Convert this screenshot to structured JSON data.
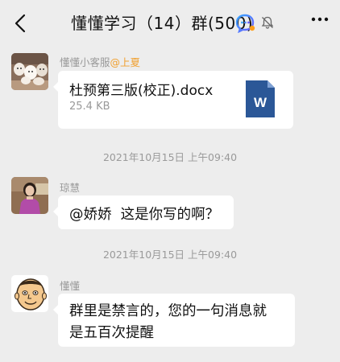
{
  "header": {
    "title": "懂懂学习（14）群(500)",
    "back_icon": "chevron-left-icon",
    "chat_icon": "chat-bubble-icon",
    "mute_icon": "bell-muted-icon",
    "more_icon": "more-icon"
  },
  "messages": [
    {
      "type": "file",
      "sender": "懂懂小客服",
      "mention": "@上夏",
      "file_name": "杜预第三版(校正).docx",
      "file_size": "25.4 KB",
      "file_icon_label": "W",
      "avatar": "plush-toys-avatar"
    },
    {
      "type": "time",
      "text": "2021年10月15日 上午09:40"
    },
    {
      "type": "text",
      "sender": "琼慧",
      "text": "@娇娇  这是你写的啊？",
      "avatar": "woman-portrait-avatar"
    },
    {
      "type": "time",
      "text": "2021年10月15日 上午09:40"
    },
    {
      "type": "text",
      "sender": "懂懂",
      "line1": "群里是禁言的，您的一句消息就",
      "line2": "是五百次提醒",
      "avatar": "cartoon-face-avatar"
    }
  ],
  "colors": {
    "background": "#ededed",
    "bubble": "#ffffff",
    "mention": "#f0a030",
    "word_blue": "#2b5797",
    "meta_text": "#999999"
  }
}
